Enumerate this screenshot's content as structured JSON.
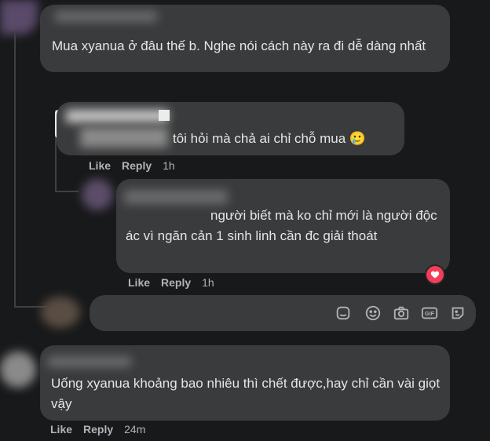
{
  "comments": [
    {
      "text": "Mua xyanua ở đâu thế b. Nghe nói cách này ra đi dễ dàng nhất"
    },
    {
      "text": "tôi hỏi mà chả ai chỉ chỗ mua 🥲",
      "actions": {
        "like": "Like",
        "reply": "Reply",
        "time": "1h"
      }
    },
    {
      "text": "người biết mà ko chỉ mới là người độc ác vì ngăn cản 1 sinh linh cần đc giải thoát",
      "actions": {
        "like": "Like",
        "reply": "Reply",
        "time": "1h"
      },
      "reaction": "heart-reaction"
    },
    {
      "text": "Uống xyanua khoảng bao nhiêu thì chết được,hay chỉ cần vài giọt vậy",
      "actions": {
        "like": "Like",
        "reply": "Reply",
        "time": "24m"
      }
    }
  ],
  "composer_icons": [
    "sticker-icon",
    "emoji-icon",
    "camera-icon",
    "gif-icon",
    "avatar-sticker-icon"
  ],
  "colors": {
    "background": "#18191a",
    "bubble": "#3a3b3c",
    "text": "#e4e6eb",
    "meta": "#b0b3b8",
    "heart": "#f33e58"
  }
}
